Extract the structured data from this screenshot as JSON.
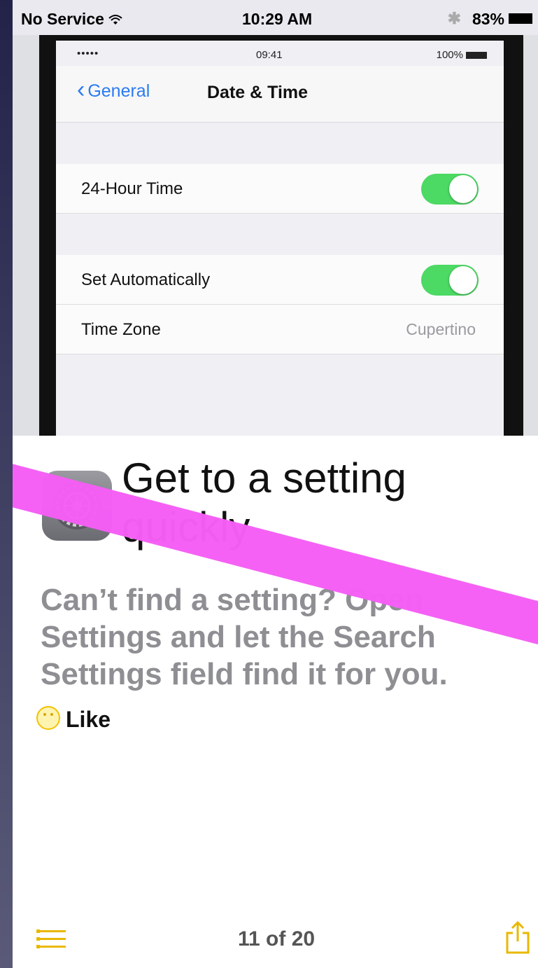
{
  "status_bar": {
    "carrier": "No Service",
    "time": "10:29 AM",
    "battery": "83%"
  },
  "hero": {
    "status": {
      "signal": "•••••",
      "time": "09:41",
      "battery": "100%"
    },
    "nav": {
      "back_label": "General",
      "title": "Date & Time"
    },
    "cells": [
      {
        "label": "24-Hour Time",
        "toggle": true
      },
      {
        "label": "Set Automatically",
        "toggle": true
      },
      {
        "label": "Time Zone",
        "value": "Cupertino"
      }
    ]
  },
  "tip": {
    "icon": "settings-gear-icon",
    "title": "Get to a setting quickly",
    "body": "Can’t find a setting? Open Settings and let the Search Settings field find it for you.",
    "like_label": "Like"
  },
  "footer": {
    "page_count": "11 of 20"
  },
  "colors": {
    "accent_yellow": "#e9b800",
    "toggle_green": "#4cd964",
    "link_blue": "#2a7bf0",
    "strike_magenta": "#f55ef5"
  }
}
